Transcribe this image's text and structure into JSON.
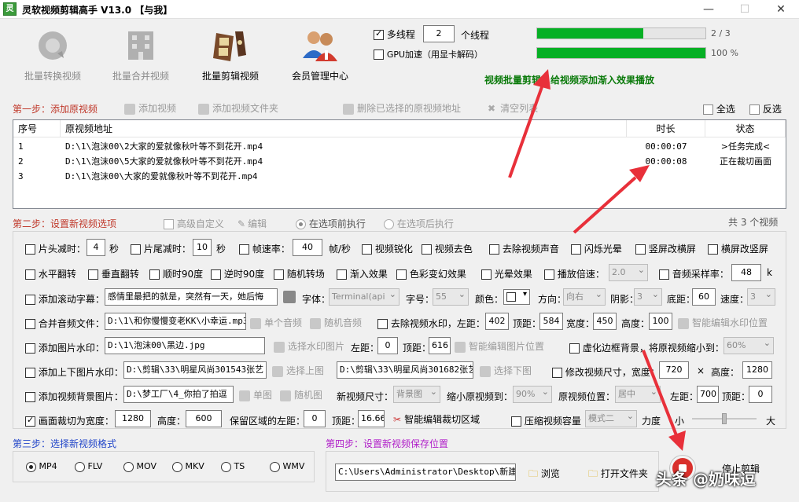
{
  "window": {
    "title": "灵软视频剪辑高手 V13.0  【与我】",
    "icon_text": "灵",
    "minimize": "—",
    "maximize": "☐",
    "close": "✕"
  },
  "toolbar": {
    "items": [
      {
        "label": "批量转换视频",
        "icon": "convert-video-icon",
        "enabled": false
      },
      {
        "label": "批量合并视频",
        "icon": "merge-video-icon",
        "enabled": false
      },
      {
        "label": "批量剪辑视频",
        "icon": "film-edit-icon",
        "enabled": true
      },
      {
        "label": "会员管理中心",
        "icon": "members-icon",
        "enabled": true
      }
    ]
  },
  "options": {
    "multithread_label": "多线程",
    "multithread_checked": true,
    "thread_count": "2",
    "thread_unit": "个线程",
    "gpu_label": "GPU加速（用显卡解码）",
    "gpu_checked": false
  },
  "progress": {
    "bar1_fraction": 0.63,
    "bar1_text": "2 / 3",
    "bar2_fraction": 1.0,
    "bar2_text": "100 %",
    "status_text": "视频批量剪辑，给视频添加渐入效果播放"
  },
  "step1": {
    "title": "第一步：添加原视频",
    "add_video": "添加视频",
    "add_folder": "添加视频文件夹",
    "remove_selected": "删除已选择的原视频地址",
    "clear_list": "清空列表",
    "select_all": "全选",
    "invert_select": "反选"
  },
  "table": {
    "headers": {
      "index": "序号",
      "path": "原视频地址",
      "duration": "时长",
      "status": "状态"
    },
    "rows": [
      {
        "index": "1",
        "path": "D:\\1\\泡沫00\\2大家的爱就像秋叶等不到花开.mp4",
        "duration": "00:00:07",
        "status": ">任务完成<"
      },
      {
        "index": "2",
        "path": "D:\\1\\泡沫00\\5大家的爱就像秋叶等不到花开.mp4",
        "duration": "00:00:08",
        "status": "正在裁切画面"
      },
      {
        "index": "3",
        "path": "D:\\1\\泡沫00\\大家的爱就像秋叶等不到花开.mp4",
        "duration": "",
        "status": ""
      }
    ],
    "count_text": "共 3 个视频"
  },
  "step2": {
    "title": "第二步：设置新视频选项",
    "advanced": "高级自定义",
    "edit": "编辑",
    "before_exec": "在选项前执行",
    "after_exec": "在选项后执行",
    "row1": {
      "head_cut": "片头减时：",
      "head_val": "4",
      "sec1": "秒",
      "tail_cut": "片尾减时：",
      "tail_val": "10",
      "sec2": "秒",
      "fps": "帧速率：",
      "fps_val": "40",
      "fps_unit": "帧/秒",
      "sharpen": "视频锐化",
      "decolor": "视频去色",
      "mute": "去除视频声音",
      "flash": "闪烁光晕",
      "v2h": "竖屏改横屏",
      "h2v": "横屏改竖屏"
    },
    "row2": {
      "hflip": "水平翻转",
      "vflip": "垂直翻转",
      "cw90": "顺时90度",
      "ccw90": "逆时90度",
      "random_trans": "随机转场",
      "fade_in": "渐入效果",
      "color_change": "色彩变幻效果",
      "halo": "光晕效果",
      "speed": "播放倍速：",
      "speed_val": "2.0",
      "sample_rate": "音频采样率：",
      "sample_val": "48",
      "sample_unit": "k"
    },
    "row3": {
      "scroll_sub": "添加滚动字幕：",
      "scroll_text": "感情里最把的就是，突然有一天，她后悔",
      "font": "字体：",
      "font_val": "Terminal(api",
      "size": "字号：",
      "size_val": "55",
      "color": "颜色：",
      "direction": "方向：",
      "direction_val": "向右",
      "shadow": "阴影：",
      "shadow_val": "3",
      "bottom": "底距：",
      "bottom_val": "60",
      "speed": "速度：",
      "speed_val": "3"
    },
    "row4": {
      "merge_audio": "合并音频文件：",
      "audio_path": "D:\\1\\和你慢慢变老KK\\小幸运.mp3",
      "single_audio": "单个音频",
      "random_audio": "随机音频",
      "remove_wm": "去除视频水印，左距：",
      "wm_left": "402",
      "wm_top_label": "顶距：",
      "wm_top": "584",
      "wm_width_label": "宽度：",
      "wm_width": "450",
      "wm_height_label": "高度：",
      "wm_height": "100",
      "smart_wm": "智能编辑水印位置"
    },
    "row5": {
      "img_wm": "添加图片水印：",
      "img_path": "D:\\1\\泡沫00\\黑边.jpg",
      "choose_img": "选择水印图片",
      "left_label": "左距：",
      "left_val": "0",
      "top_label": "顶距：",
      "top_val": "616",
      "smart_img": "智能编辑图片位置",
      "blur_bg": "虚化边框背景，将原视频缩小到：",
      "blur_val": "60%"
    },
    "row6": {
      "tb_img_wm": "添加上下图片水印：",
      "top_img": "D:\\剪辑\\33\\明星风尚301543张艺",
      "choose_top": "选择上图",
      "bottom_img": "D:\\剪辑\\33\\明星风尚301682张艺",
      "choose_bottom": "选择下图",
      "resize": "修改视频尺寸，宽度：",
      "width_val": "720",
      "x": "×",
      "height_label": "高度：",
      "height_val": "1280"
    },
    "row7": {
      "bg_img": "添加视频背景图片：",
      "bg_path": "D:\\梦工厂\\4_你拍了拍逗",
      "single_img": "单图",
      "random_img": "随机图",
      "new_size": "新视频尺寸：",
      "new_size_val": "背景图",
      "shrink": "缩小原视频到：",
      "shrink_val": "90%",
      "position": "原视频位置：",
      "position_val": "居中",
      "left_label": "左距：",
      "left_val": "700",
      "top_label": "顶距：",
      "top_val": "0"
    },
    "row8": {
      "crop": "画面裁切为宽度：",
      "crop_w": "1280",
      "height_label": "高度：",
      "crop_h": "600",
      "keep_left": "保留区域的左距：",
      "keep_left_val": "0",
      "top_label": "顶距：",
      "keep_top_val": "16.66",
      "smart_crop": "智能编辑裁切区域",
      "compress": "压缩视频容量",
      "mode_val": "模式二",
      "strength": "力度",
      "small": "小",
      "large": "大",
      "strength_level": 0.5
    }
  },
  "step3": {
    "title": "第三步：选择新视频格式",
    "formats": [
      "MP4",
      "FLV",
      "MOV",
      "MKV",
      "TS",
      "WMV"
    ],
    "selected": "MP4"
  },
  "step4": {
    "title": "第四步：设置新视频保存位置",
    "path": "C:\\Users\\Administrator\\Desktop\\新建文件",
    "browse": "浏览",
    "open_folder": "打开文件夹",
    "stop": "停止剪辑"
  },
  "watermark": {
    "text": "头条 @奶味逗"
  }
}
